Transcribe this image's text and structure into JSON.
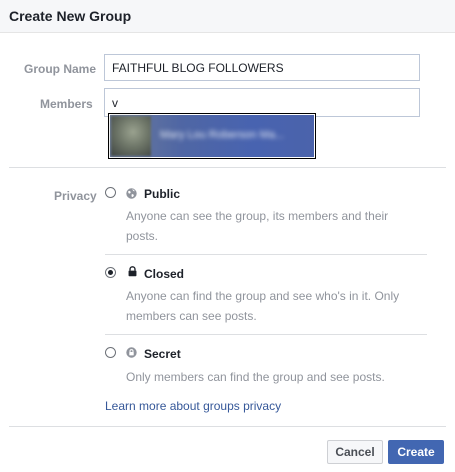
{
  "dialog": {
    "title": "Create New Group"
  },
  "form": {
    "group_name_label": "Group Name",
    "group_name_value": "FAITHFUL BLOG FOLLOWERS",
    "members_label": "Members",
    "members_value": "v",
    "suggestion_name": "Mary Lou Roberson Ma..."
  },
  "privacy": {
    "label": "Privacy",
    "options": [
      {
        "title": "Public",
        "icon": "globe-icon",
        "description_lines": [
          "Anyone can see the group, its members and their",
          "posts."
        ],
        "selected": false
      },
      {
        "title": "Closed",
        "icon": "lock-icon",
        "description_lines": [
          "Anyone can find the group and see who's in it. Only",
          "members can see posts."
        ],
        "selected": true
      },
      {
        "title": "Secret",
        "icon": "secret-icon",
        "description_lines": [
          "Only members can find the group and see posts."
        ],
        "selected": false
      }
    ],
    "learn_more": "Learn more about groups privacy"
  },
  "buttons": {
    "cancel": "Cancel",
    "create": "Create"
  },
  "colors": {
    "accent": "#4267b2",
    "link": "#365899",
    "muted_text": "#90949c",
    "header_bg": "#f6f7f9"
  }
}
